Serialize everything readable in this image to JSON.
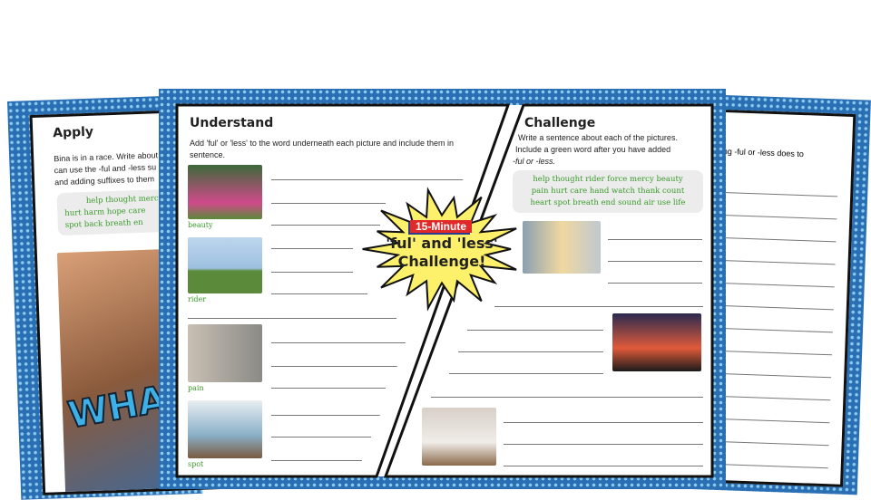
{
  "apply": {
    "title": "Apply",
    "instructions": [
      "Bina is in a race. Write about",
      "can use the -ful and -less su",
      "and adding suffixes to them"
    ],
    "words": [
      "help thought mercy",
      "hurt harm hope care",
      "spot back breath en"
    ],
    "comic_text": "WHA"
  },
  "understand": {
    "title": "Understand",
    "instructions": "Add 'ful' or 'less' to the word underneath each picture and include them in sentence.",
    "pictures": [
      {
        "word": "beauty"
      },
      {
        "word": "rider"
      },
      {
        "word": "pain"
      },
      {
        "word": "spot"
      }
    ]
  },
  "challenge": {
    "title": "Challenge",
    "instructions": [
      "Write a sentence about each of the pictures.",
      "Include a green word after you have added",
      "-ful or -less."
    ],
    "words": [
      "help thought rider force mercy beauty",
      "pain hurt care hand watch thank count",
      "heart spot breath end sound air use life"
    ]
  },
  "back_sheet": {
    "instructions": "ing -ful or -less does to"
  },
  "badge": {
    "tag": "15-Minute",
    "line1": "'ful' and 'less'",
    "line2": "Challenge!"
  },
  "colors": {
    "frame_blue": "#2a6fb3",
    "word_green": "#3a9a2a",
    "badge_yellow": "#fdf06a",
    "tag_red": "#e02a2a"
  }
}
